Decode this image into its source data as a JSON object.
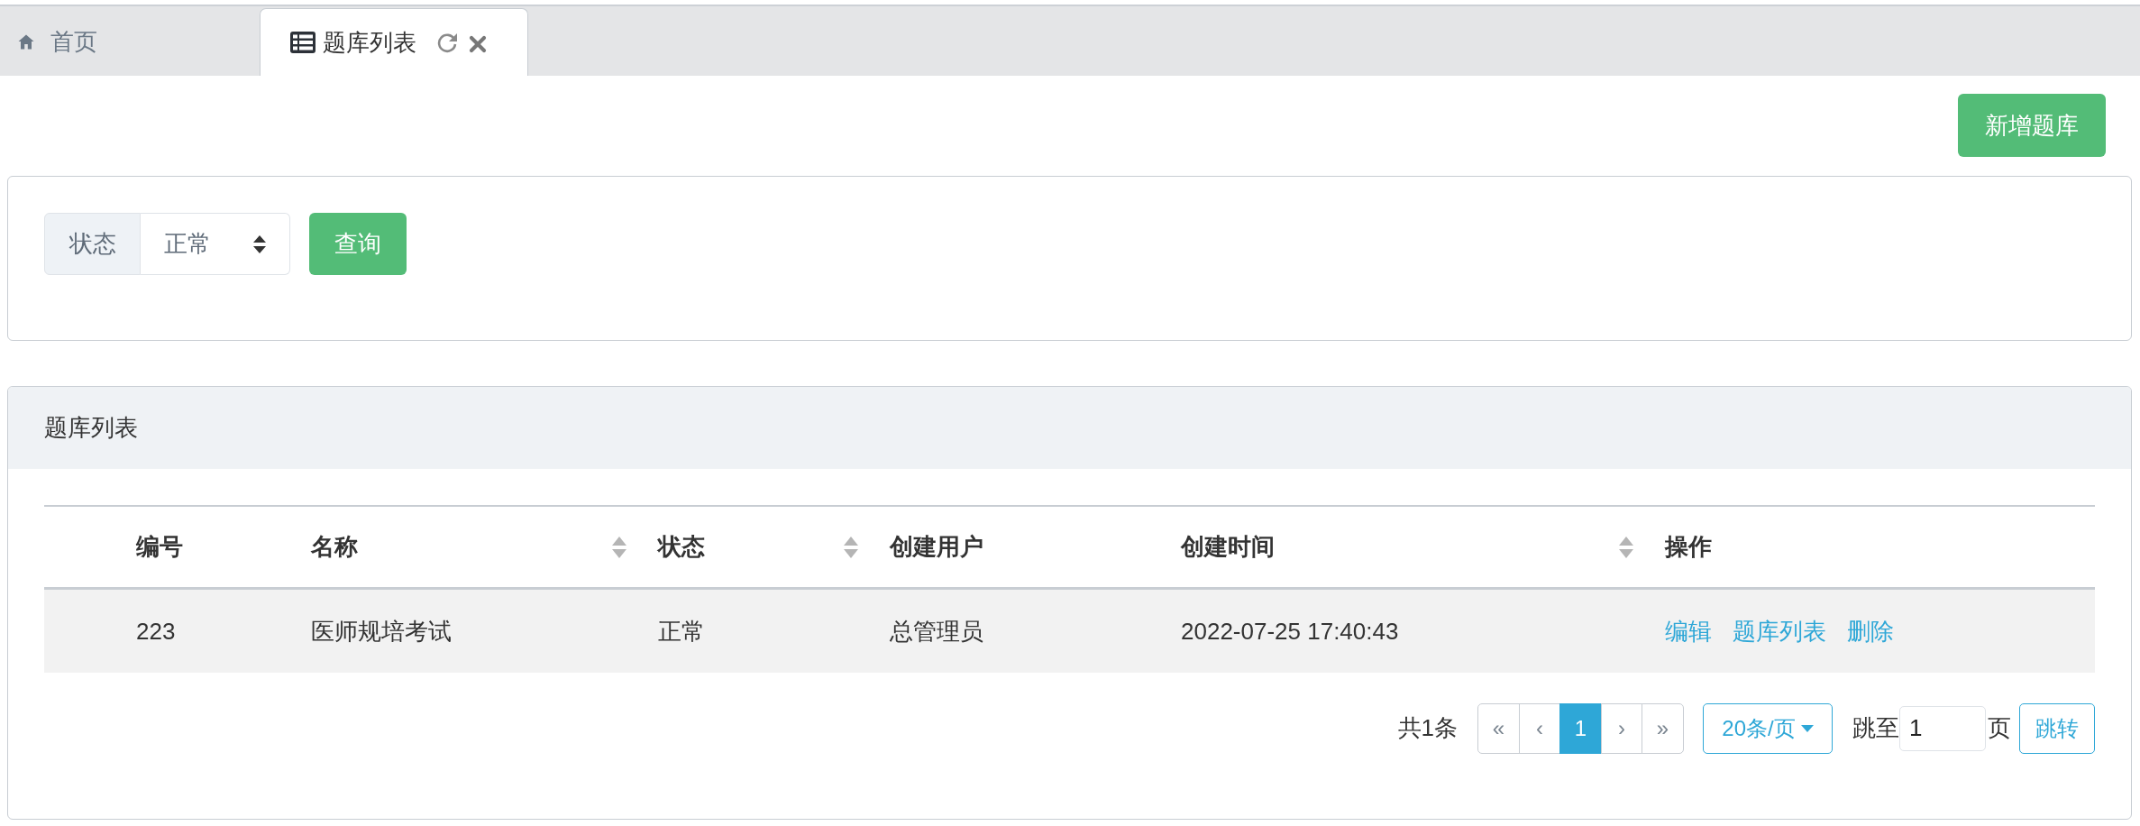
{
  "tabs": [
    {
      "label": "首页",
      "kind": "home",
      "selected": false
    },
    {
      "label": "题库列表",
      "kind": "list",
      "selected": true
    }
  ],
  "toolbar": {
    "add_button": "新增题库"
  },
  "filter": {
    "label": "状态",
    "select_value": "正常",
    "submit_button": "查询"
  },
  "table_panel": {
    "title": "题库列表",
    "columns": [
      {
        "label": "编号",
        "sortable": false
      },
      {
        "label": "名称",
        "sortable": true
      },
      {
        "label": "状态",
        "sortable": true
      },
      {
        "label": "创建用户",
        "sortable": false
      },
      {
        "label": "创建时间",
        "sortable": true
      },
      {
        "label": "操作",
        "sortable": false
      }
    ],
    "rows": [
      {
        "cells": [
          "223",
          "医师规培考试",
          "正常",
          "总管理员",
          "2022-07-25 17:40:43"
        ],
        "actions": [
          "编辑",
          "题库列表",
          "删除"
        ]
      }
    ],
    "pagination": {
      "total": "共1条",
      "pages": [
        {
          "label": "«",
          "selected": false
        },
        {
          "label": "‹",
          "selected": false
        },
        {
          "label": "1",
          "selected": true
        },
        {
          "label": "›",
          "selected": false
        },
        {
          "label": "»",
          "selected": false
        }
      ],
      "page_size": "20条/页",
      "jump_label": "跳至",
      "jump_value": "1",
      "jump_unit": "页",
      "jump_button": "跳转"
    }
  }
}
